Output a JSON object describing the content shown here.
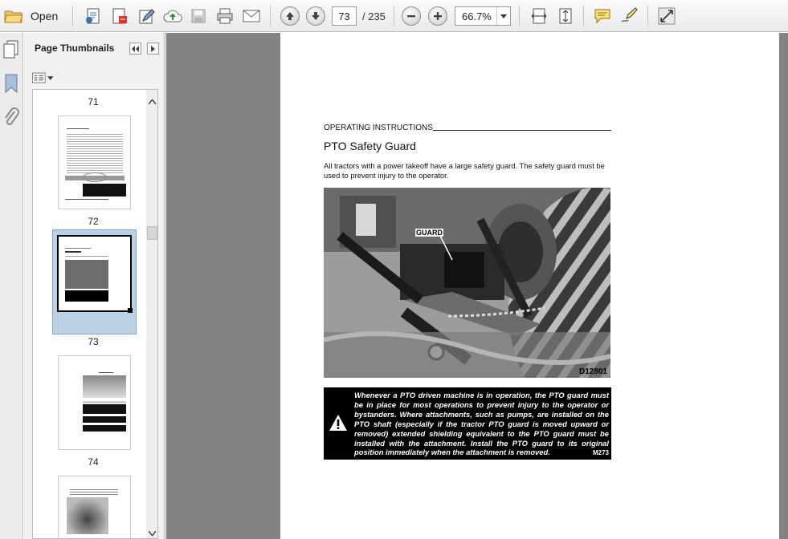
{
  "toolbar": {
    "open_label": "Open",
    "current_page": "73",
    "page_total": "/ 235",
    "zoom": "66.7%"
  },
  "side_panel": {
    "title": "Page Thumbnails",
    "thumbnails": [
      {
        "label": "71"
      },
      {
        "label": "72"
      },
      {
        "label": "73",
        "selected": true
      },
      {
        "label": "74"
      }
    ]
  },
  "document": {
    "section_header": "OPERATING INSTRUCTIONS",
    "title": "PTO Safety Guard",
    "intro": "All tractors with a power takeoff have a large safety guard. The safety guard must be used to prevent injury to the operator.",
    "photo_callout": "GUARD",
    "photo_id": "D12801",
    "warning_text": "Whenever a PTO driven machine is in operation, the PTO guard must be in place for most operations to prevent injury to the operator or bystanders. Where attachments, such as pumps, are installed on the PTO shaft (especially if the tractor PTO guard is moved upward or removed) extended shielding equivalent to the PTO guard must be installed with the attachment. Install the PTO guard to its original position immediately when the attachment is removed.",
    "warning_code": "M273"
  },
  "icons": [
    "folder-open-icon",
    "print-settings-icon",
    "create-pdf-icon",
    "edit-icon",
    "upload-icon",
    "save-icon",
    "print-icon",
    "email-icon",
    "page-up-icon",
    "page-down-icon",
    "zoom-out-icon",
    "zoom-in-icon",
    "fit-width-icon",
    "fit-page-icon",
    "comment-icon",
    "sign-icon",
    "fullscreen-icon",
    "page-thumbnails-icon",
    "bookmarks-icon",
    "attachments-icon",
    "warning-icon"
  ],
  "colors": {
    "viewer_bg": "#838383",
    "selection": "#b9d1e5",
    "warning_bg": "#000000"
  }
}
